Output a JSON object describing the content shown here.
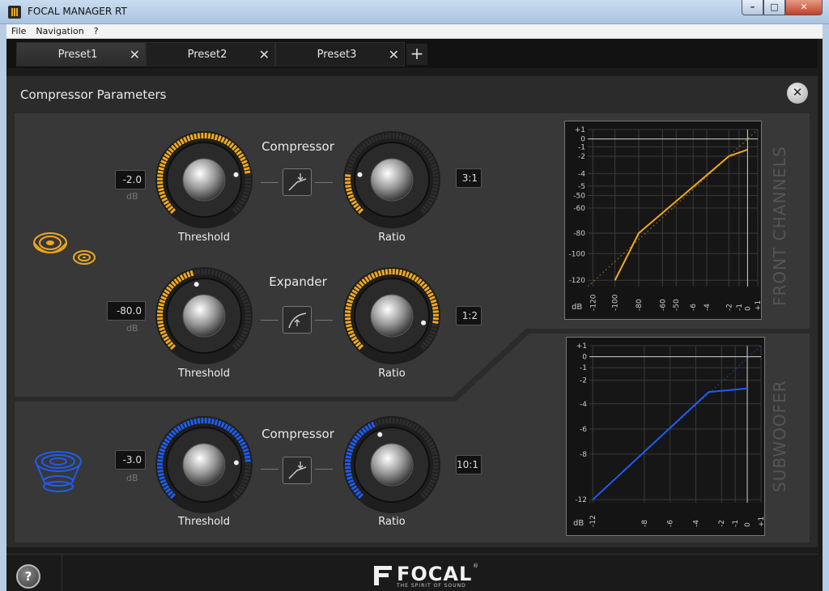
{
  "window": {
    "title": "FOCAL MANAGER RT",
    "min": "–",
    "max": "□",
    "close": "✕"
  },
  "menu": [
    "File",
    "Navigation",
    "?"
  ],
  "tabs": [
    {
      "label": "Preset1",
      "close": "✕"
    },
    {
      "label": "Preset2",
      "close": "✕"
    },
    {
      "label": "Preset3",
      "close": "✕"
    }
  ],
  "add_tab": "+",
  "panel": {
    "title": "Compressor Parameters",
    "close": "✕"
  },
  "front": {
    "compressor": {
      "title": "Compressor",
      "threshold_value": "-2.0",
      "threshold_unit": "dB",
      "threshold_label": "Threshold",
      "ratio_value": "3:1",
      "ratio_label": "Ratio"
    },
    "expander": {
      "title": "Expander",
      "threshold_value": "-80.0",
      "threshold_unit": "dB",
      "threshold_label": "Threshold",
      "ratio_value": "1:2",
      "ratio_label": "Ratio"
    },
    "graph_label": "FRONT CHANNELS"
  },
  "sub": {
    "compressor": {
      "title": "Compressor",
      "threshold_value": "-3.0",
      "threshold_unit": "dB",
      "threshold_label": "Threshold",
      "ratio_value": "10:1",
      "ratio_label": "Ratio"
    },
    "graph_label": "SUBWOOFER"
  },
  "colors": {
    "orange": "#f0a81e",
    "blue": "#1e5cf0"
  },
  "footer": {
    "help": "?",
    "logo": "FOCAL",
    "tagline": "THE SPIRIT OF SOUND",
    "reg": "®"
  },
  "chart_data": [
    {
      "type": "line",
      "title": "",
      "xlabel": "dB",
      "ylabel": "",
      "x_ticks": [
        "-120",
        "-100",
        "-80",
        "-60",
        "-50",
        "-6",
        "-4",
        "-2",
        "-1",
        "0",
        "+1"
      ],
      "y_ticks": [
        "+1",
        "0",
        "-1",
        "-2",
        "-4",
        "-5",
        "-50",
        "-60",
        "-80",
        "-100",
        "-120"
      ],
      "series": [
        {
          "values": [
            [
              -100,
              -120
            ],
            [
              -80,
              -80
            ],
            [
              -2,
              -2
            ],
            [
              0,
              -1.3
            ]
          ]
        }
      ],
      "reference": "dashed unity line",
      "color": "#f0a81e"
    },
    {
      "type": "line",
      "title": "",
      "xlabel": "dB",
      "ylabel": "",
      "x_ticks": [
        "-12",
        "-8",
        "-6",
        "-4",
        "-2",
        "-1",
        "0",
        "+1"
      ],
      "y_ticks": [
        "+1",
        "0",
        "-1",
        "-2",
        "-4",
        "-6",
        "-8",
        "-12"
      ],
      "series": [
        {
          "values": [
            [
              -12,
              -12
            ],
            [
              -3,
              -3
            ],
            [
              0,
              -2.7
            ]
          ]
        }
      ],
      "reference": "dashed unity line",
      "color": "#1e5cf0"
    }
  ]
}
